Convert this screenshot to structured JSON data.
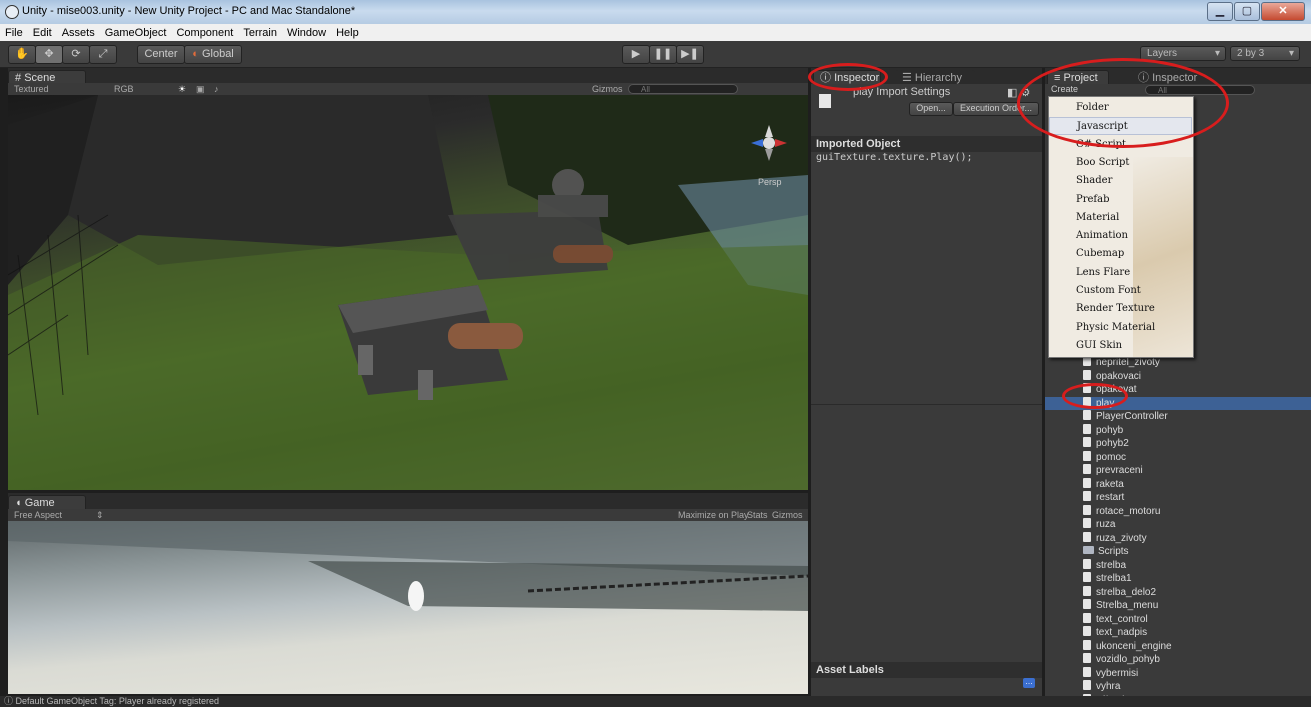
{
  "window": {
    "title": "Unity - mise003.unity - New Unity Project - PC and Mac Standalone*"
  },
  "menubar": [
    "File",
    "Edit",
    "Assets",
    "GameObject",
    "Component",
    "Terrain",
    "Window",
    "Help"
  ],
  "toolbar": {
    "pivot": "Center",
    "space": "Global",
    "layers": "Layers",
    "layout": "2 by 3"
  },
  "scene": {
    "tab": "Scene",
    "render_mode": "Textured",
    "color_mode": "RGB",
    "gizmos": "Gizmos",
    "search": "All",
    "persp": "Persp"
  },
  "game": {
    "tab": "Game",
    "aspect": "Free Aspect",
    "maximize": "Maximize on Play",
    "stats": "Stats",
    "gizmos": "Gizmos"
  },
  "inspector": {
    "tab": "Inspector",
    "tab2": "Hierarchy",
    "asset_title": "play Import Settings",
    "open_btn": "Open...",
    "exec_btn": "Execution Order...",
    "section": "Imported Object",
    "code": "guiTexture.texture.Play();",
    "labels": "Asset Labels"
  },
  "project": {
    "tab": "Project",
    "tab2": "Inspector",
    "create": "Create",
    "search": "All",
    "files": [
      "nepritel_zivoty",
      "opakovaci",
      "opakovat",
      "play",
      "PlayerController",
      "pohyb",
      "pohyb2",
      "pomoc",
      "prevraceni",
      "raketa",
      "restart",
      "rotace_motoru",
      "ruza",
      "ruza_zivoty",
      "Scripts",
      "strelba",
      "strelba1",
      "strelba_delo2",
      "Strelba_menu",
      "text_control",
      "text_nadpis",
      "ukonceni_engine",
      "vozidlo_pohyb",
      "vybermisi",
      "vyhra",
      "výbuch"
    ],
    "selected": "play"
  },
  "create_menu": [
    "Folder",
    "Javascript",
    "C# Script",
    "Boo Script",
    "Shader",
    "Prefab",
    "Material",
    "Animation",
    "Cubemap",
    "Lens Flare",
    "Custom Font",
    "Render Texture",
    "Physic Material",
    "GUI Skin"
  ],
  "status": "Default GameObject Tag: Player already registered"
}
